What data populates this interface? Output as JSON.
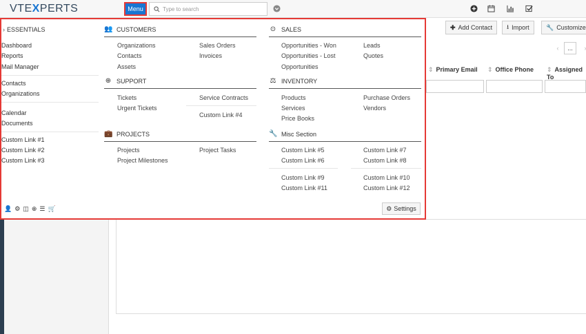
{
  "header": {
    "logo_part1": "VTE",
    "logo_x": "X",
    "logo_part2": "PERTS",
    "menu_label": "Menu",
    "search_placeholder": "Type to search"
  },
  "toolbar": {
    "add_contact": "Add Contact",
    "import": "Import",
    "customize": "Customize"
  },
  "list": {
    "columns": [
      "Primary Email",
      "Office Phone",
      "Assigned To"
    ],
    "pager_more": "..."
  },
  "essentials": {
    "heading": "ESSENTIALS",
    "group1": [
      "Dashboard",
      "Reports",
      "Mail Manager"
    ],
    "group2": [
      "Contacts",
      "Organizations"
    ],
    "group3": [
      "Calendar",
      "Documents"
    ],
    "group4": [
      "Custom Link #1",
      "Custom Link #2",
      "Custom Link #3"
    ]
  },
  "sections": {
    "customers": {
      "title": "CUSTOMERS",
      "col1": [
        "Organizations",
        "Contacts",
        "Assets"
      ],
      "col2": [
        "Sales Orders",
        "Invoices"
      ]
    },
    "sales": {
      "title": "SALES",
      "col1": [
        "Opportunities - Won",
        "Opportunities - Lost",
        "Opportunities"
      ],
      "col2": [
        "Leads",
        "Quotes"
      ]
    },
    "support": {
      "title": "SUPPORT",
      "col1": [
        "Tickets",
        "Urgent Tickets"
      ],
      "col2": [
        "Service Contracts",
        "Custom Link #4"
      ]
    },
    "inventory": {
      "title": "INVENTORY",
      "col1": [
        "Products",
        "Services",
        "Price Books"
      ],
      "col2": [
        "Purchase Orders",
        "Vendors"
      ]
    },
    "projects": {
      "title": "PROJECTS",
      "col1": [
        "Projects",
        "Project Milestones"
      ],
      "col2": [
        "Project Tasks"
      ]
    },
    "misc": {
      "title": "Misc Section",
      "col1": [
        "Custom Link #5",
        "Custom Link #6",
        "Custom Link #9",
        "Custom Link #11"
      ],
      "col2": [
        "Custom Link #7",
        "Custom Link #8",
        "Custom Link #10",
        "Custom Link #12"
      ]
    }
  },
  "settings_label": "Settings",
  "colors": {
    "accent": "#1976d2",
    "highlight_border": "#e53935",
    "sidebar": "#2c3e50"
  }
}
